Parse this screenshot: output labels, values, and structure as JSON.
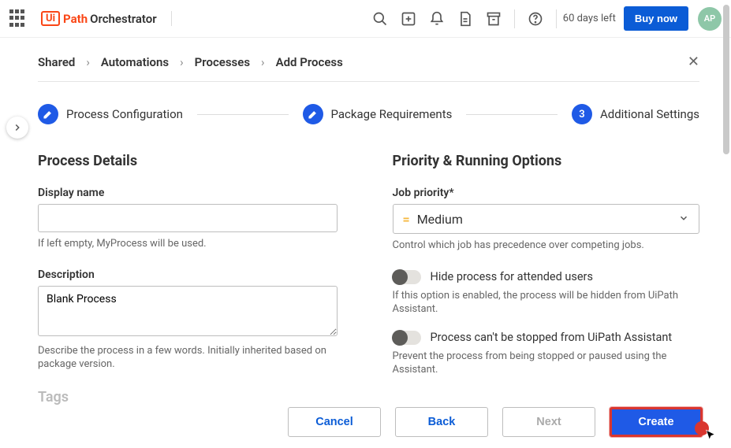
{
  "header": {
    "product": "Orchestrator",
    "logo_mark": "Ui",
    "trial": "60 days left",
    "buy": "Buy now",
    "avatar": "AP"
  },
  "breadcrumb": {
    "items": [
      "Shared",
      "Automations",
      "Processes",
      "Add Process"
    ]
  },
  "stepper": {
    "steps": [
      {
        "label": "Process Configuration",
        "state": "done"
      },
      {
        "label": "Package Requirements",
        "state": "done"
      },
      {
        "label": "Additional Settings",
        "state": "current",
        "num": "3"
      }
    ]
  },
  "left": {
    "heading": "Process Details",
    "display_name": {
      "label": "Display name",
      "value": "",
      "hint": "If left empty, MyProcess will be used."
    },
    "description": {
      "label": "Description",
      "value": "Blank Process",
      "hint": "Describe the process in a few words. Initially inherited based on package version."
    },
    "tags_label": "Tags"
  },
  "right": {
    "heading": "Priority & Running Options",
    "priority": {
      "label": "Job priority*",
      "value": "Medium",
      "hint": "Control which job has precedence over competing jobs."
    },
    "hide": {
      "label": "Hide process for attended users",
      "hint": "If this option is enabled, the process will be hidden from UiPath Assistant."
    },
    "nostop": {
      "label": "Process can't be stopped from UiPath Assistant",
      "hint": "Prevent the process from being stopped or paused using the Assistant."
    }
  },
  "footer": {
    "cancel": "Cancel",
    "back": "Back",
    "next": "Next",
    "create": "Create"
  }
}
